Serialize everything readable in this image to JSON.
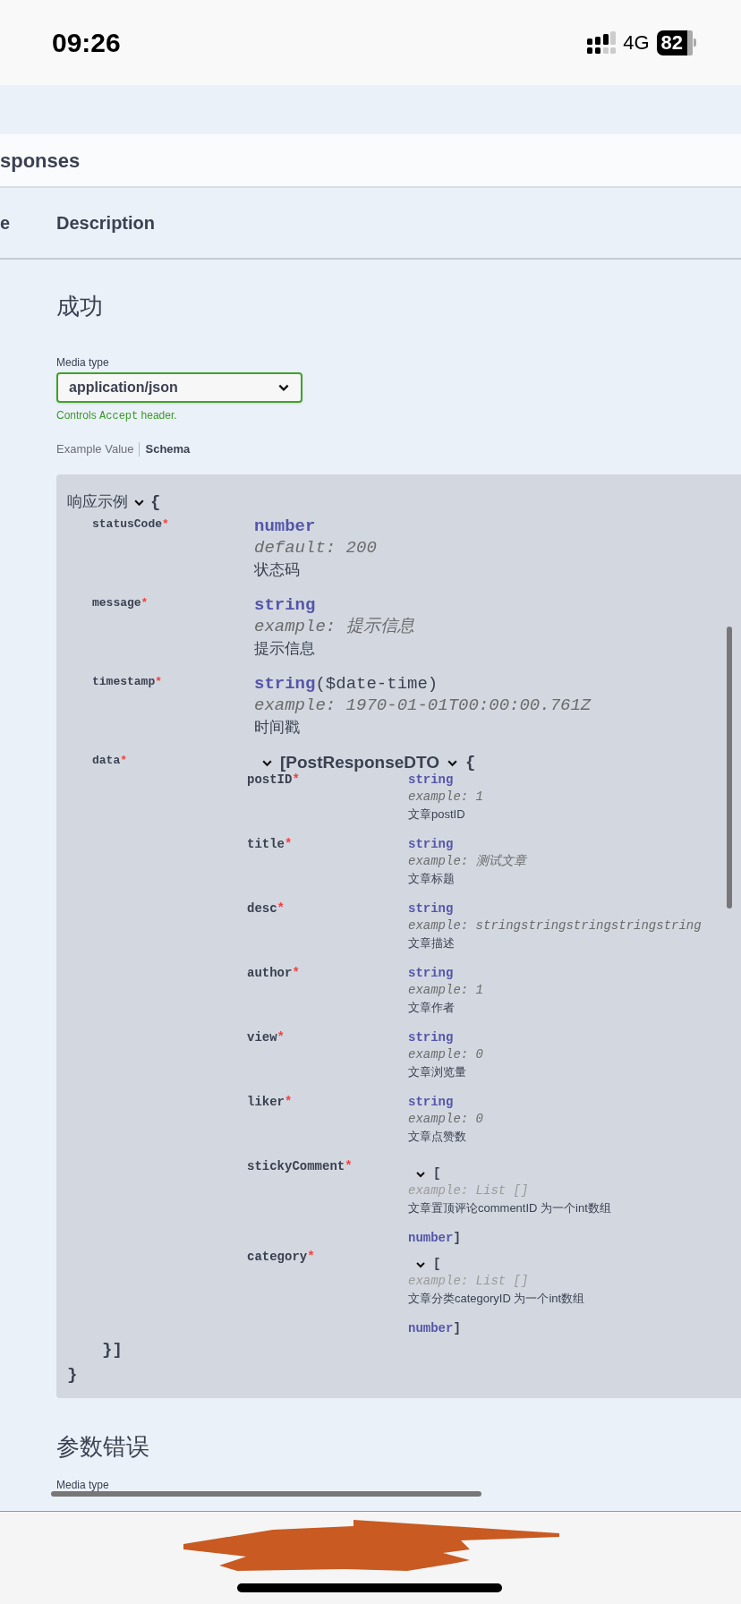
{
  "status_bar": {
    "time": "09:26",
    "network": "4G",
    "battery": "82"
  },
  "section_title": "sponses",
  "table_header": [
    "e",
    "Description"
  ],
  "response": {
    "title": "成功",
    "media_type_label": "Media type",
    "media_type": "application/json",
    "hint": [
      {
        "kind": "text",
        "text": "Controls"
      },
      {
        "kind": "code",
        "text": "Accept"
      },
      {
        "kind": "text",
        "text": "header."
      }
    ],
    "tabs": [
      {
        "label": "Example Value",
        "selected": false
      },
      {
        "label": "Schema",
        "selected": true
      }
    ],
    "schema": {
      "title": "响应示例",
      "expanded": true,
      "open": "{",
      "close": "}",
      "properties": [
        {
          "kind": "scalar",
          "name": "statusCode",
          "required_mark": "*",
          "type": "number",
          "example": "default: 200",
          "description": "状态码"
        },
        {
          "kind": "scalar",
          "name": "message",
          "required_mark": "*",
          "type": "string",
          "example": "example: 提示信息",
          "description": "提示信息"
        },
        {
          "kind": "scalar",
          "name": "timestamp",
          "required_mark": "*",
          "type": "string",
          "format": "($date-time)",
          "example": "example: 1970-01-01T00:00:00.761Z",
          "description": "时间戳"
        },
        {
          "kind": "model_array",
          "name": "data",
          "required_mark": "*",
          "expanded": true,
          "open": "[",
          "model": "PostResponseDTO",
          "model_expanded": true,
          "brace": "{",
          "close": "}]",
          "properties": [
            {
              "kind": "scalar",
              "name": "postID",
              "required_mark": "*",
              "type": "string",
              "example": "example: 1",
              "description": "文章postID"
            },
            {
              "kind": "scalar",
              "name": "title",
              "required_mark": "*",
              "type": "string",
              "example": "example: 测试文章",
              "description": "文章标题"
            },
            {
              "kind": "scalar",
              "name": "desc",
              "required_mark": "*",
              "type": "string",
              "example": "example: stringstringstringstringstring",
              "description": "文章描述"
            },
            {
              "kind": "scalar",
              "name": "author",
              "required_mark": "*",
              "type": "string",
              "example": "example: 1",
              "description": "文章作者"
            },
            {
              "kind": "scalar",
              "name": "view",
              "required_mark": "*",
              "type": "string",
              "example": "example: 0",
              "description": "文章浏览量"
            },
            {
              "kind": "scalar",
              "name": "liker",
              "required_mark": "*",
              "type": "string",
              "example": "example: 0",
              "description": "文章点赞数"
            },
            {
              "kind": "array",
              "name": "stickyComment",
              "required_mark": "*",
              "expanded": true,
              "open": "[",
              "example": "example: List []",
              "description": "文章置顶评论commentID 为一个int数组",
              "item_type": "number",
              "close": "]"
            },
            {
              "kind": "array",
              "name": "category",
              "required_mark": "*",
              "expanded": true,
              "open": "[",
              "example": "example: List []",
              "description": "文章分类categoryID 为一个int数组",
              "item_type": "number",
              "close": "]"
            }
          ]
        }
      ]
    }
  },
  "next_response": {
    "title": "参数错误",
    "media_type_label": "Media type"
  }
}
